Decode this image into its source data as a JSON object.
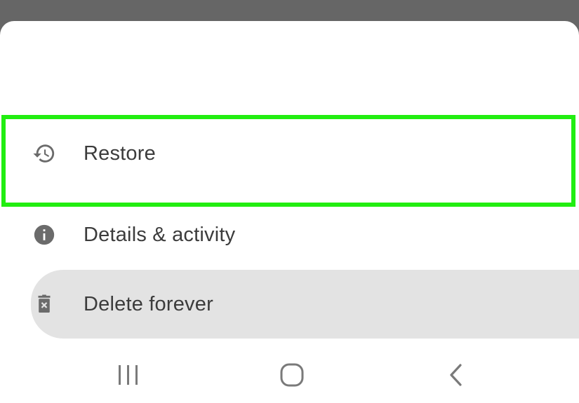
{
  "menu": {
    "items": [
      {
        "label": "Restore",
        "icon": "restore-history-icon"
      },
      {
        "label": "Details & activity",
        "icon": "info-icon"
      },
      {
        "label": "Delete forever",
        "icon": "delete-forever-icon"
      }
    ],
    "highlight_color": "#22ee11",
    "pressed_bg": "#e3e3e3"
  },
  "navbar": {
    "buttons": [
      "recents-icon",
      "home-icon",
      "back-icon"
    ]
  }
}
